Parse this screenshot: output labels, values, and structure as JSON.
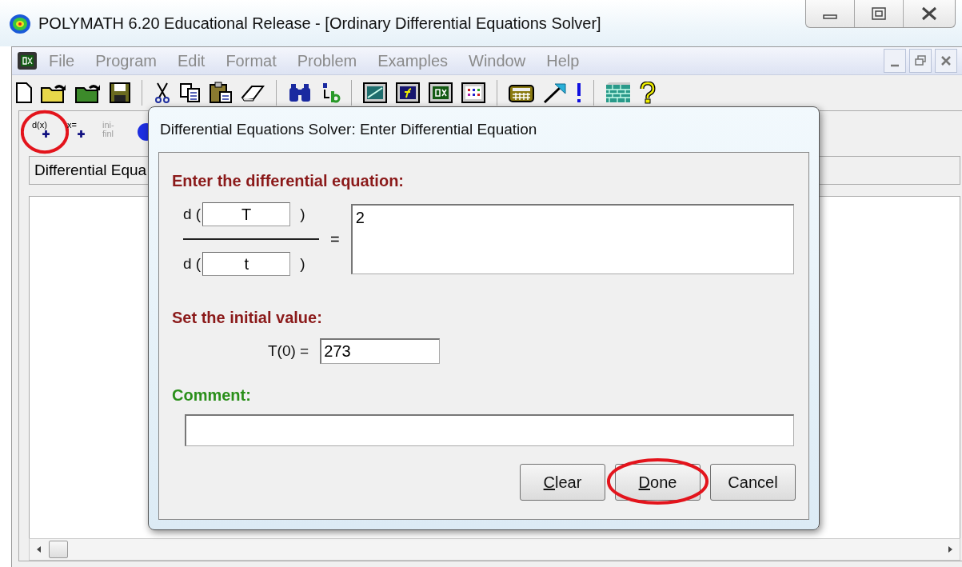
{
  "window": {
    "title": "POLYMATH 6.20 Educational Release - [Ordinary Differential Equations Solver]"
  },
  "menu": [
    {
      "label": "File",
      "disabled": true
    },
    {
      "label": "Program",
      "disabled": true
    },
    {
      "label": "Edit",
      "disabled": true
    },
    {
      "label": "Format",
      "disabled": true
    },
    {
      "label": "Problem",
      "disabled": true
    },
    {
      "label": "Examples",
      "disabled": true
    },
    {
      "label": "Window",
      "disabled": true
    },
    {
      "label": "Help",
      "disabled": true
    }
  ],
  "child_toolbar": [
    {
      "lines": [
        "d(x)"
      ],
      "circled": true
    },
    {
      "lines": [
        "x="
      ],
      "circled": false
    },
    {
      "lines": [
        "ini-",
        "finl"
      ],
      "circled": false
    }
  ],
  "child_field": {
    "value": "Differential Equa"
  },
  "dialog": {
    "title": "Differential Equations Solver: Enter Differential Equation",
    "equation_heading": "Enter the differential equation:",
    "numerator": {
      "prefix": "d (",
      "value": "T",
      "suffix": ")"
    },
    "denominator": {
      "prefix": "d (",
      "value": "t",
      "suffix": ")"
    },
    "equals": "=",
    "equation": "2",
    "initial_heading": "Set the initial value:",
    "initial_label": "T(0) =",
    "initial_value": "273",
    "comment_label": "Comment:",
    "buttons": [
      {
        "label": "Clear",
        "mnemonic": true,
        "circled": false
      },
      {
        "label": "Done",
        "mnemonic": true,
        "circled": true
      },
      {
        "label": "Cancel",
        "mnemonic": false,
        "circled": false
      }
    ]
  }
}
